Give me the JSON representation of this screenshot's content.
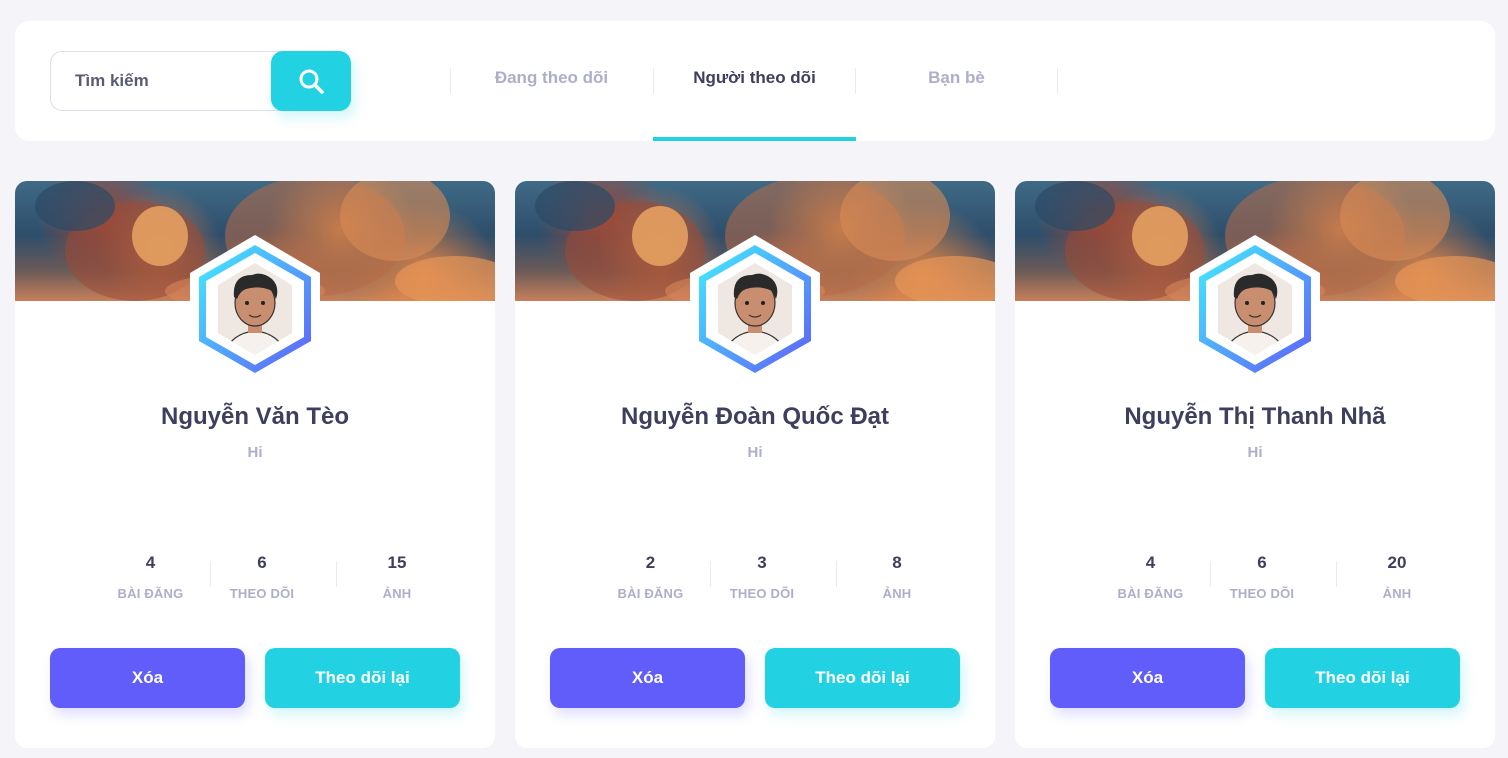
{
  "search": {
    "placeholder": "Tìm kiếm"
  },
  "tabs": [
    {
      "label": "Đang theo dõi",
      "active": false
    },
    {
      "label": "Người theo dõi",
      "active": true
    },
    {
      "label": "Bạn bè",
      "active": false
    }
  ],
  "colors": {
    "primary": "#615dfa",
    "secondary": "#23d2e2",
    "text": "#3e3f5e",
    "muted": "#adafca"
  },
  "icons": {
    "search": "magnifier-icon",
    "avatar": "user-avatar-hexagon"
  },
  "cards": [
    {
      "name": "Nguyễn Văn Tèo",
      "bio": "Hi",
      "stats": [
        {
          "value": "4",
          "label": "BÀI ĐĂNG"
        },
        {
          "value": "6",
          "label": "THEO DÕI"
        },
        {
          "value": "15",
          "label": "ẢNH"
        }
      ],
      "remove_label": "Xóa",
      "follow_label": "Theo dõi lại"
    },
    {
      "name": "Nguyễn Đoàn Quốc Đạt",
      "bio": "Hi",
      "stats": [
        {
          "value": "2",
          "label": "BÀI ĐĂNG"
        },
        {
          "value": "3",
          "label": "THEO DÕI"
        },
        {
          "value": "8",
          "label": "ẢNH"
        }
      ],
      "remove_label": "Xóa",
      "follow_label": "Theo dõi lại"
    },
    {
      "name": "Nguyễn Thị Thanh Nhã",
      "bio": "Hi",
      "stats": [
        {
          "value": "4",
          "label": "BÀI ĐĂNG"
        },
        {
          "value": "6",
          "label": "THEO DÕI"
        },
        {
          "value": "20",
          "label": "ẢNH"
        }
      ],
      "remove_label": "Xóa",
      "follow_label": "Theo dõi lại"
    }
  ]
}
